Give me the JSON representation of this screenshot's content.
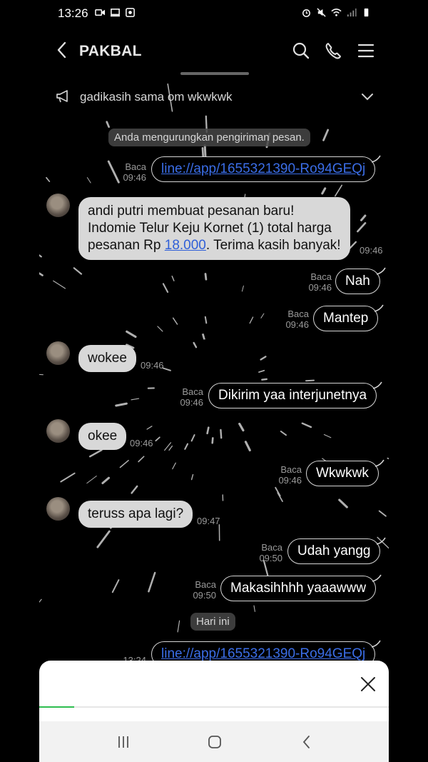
{
  "status_bar": {
    "time": "13:26"
  },
  "header": {
    "title": "PAKBAL"
  },
  "announcement": {
    "text": "gadikasih sama om wkwkwk"
  },
  "system": {
    "unsent": "Anda mengurungkan pengiriman pesan.",
    "today": "Hari ini"
  },
  "messages": {
    "m1": {
      "text": "line://app/1655321390-Ro94GEQj",
      "read": "Baca",
      "time": "09:46"
    },
    "m2": {
      "line1": "andi putri membuat pesanan baru!",
      "line2": "Indomie Telur Keju Kornet (1) total harga",
      "line3_a": "pesanan Rp ",
      "price": "18.000",
      "line3_b": ". Terima kasih banyak!",
      "time": "09:46"
    },
    "m3": {
      "text": "Nah",
      "read": "Baca",
      "time": "09:46"
    },
    "m4": {
      "text": "Mantep",
      "read": "Baca",
      "time": "09:46"
    },
    "m5": {
      "text": "wokee",
      "time": "09:46"
    },
    "m6": {
      "text": "Dikirim yaa interjunetnya",
      "read": "Baca",
      "time": "09:46"
    },
    "m7": {
      "text": "okee",
      "time": "09:46"
    },
    "m8": {
      "text": "Wkwkwk",
      "read": "Baca",
      "time": "09:46"
    },
    "m9": {
      "text": "teruss apa lagi?",
      "time": "09:47"
    },
    "m10": {
      "text": "Udah yangg",
      "read": "Baca",
      "time": "09:50"
    },
    "m11": {
      "text": "Makasihhhh yaaawww",
      "read": "Baca",
      "time": "09:50"
    },
    "m12": {
      "text": "line://app/1655321390-Ro94GEQj",
      "time": "13:24"
    }
  },
  "sheet": {
    "progress": 0.1
  },
  "colors": {
    "link": "#3b6ee8",
    "progress": "#2ebd4f"
  },
  "icons": [
    "back-icon",
    "search-icon",
    "phone-icon",
    "menu-icon",
    "megaphone-icon",
    "chevron-down-icon",
    "close-icon",
    "recents-icon",
    "home-icon",
    "nav-back-icon"
  ]
}
